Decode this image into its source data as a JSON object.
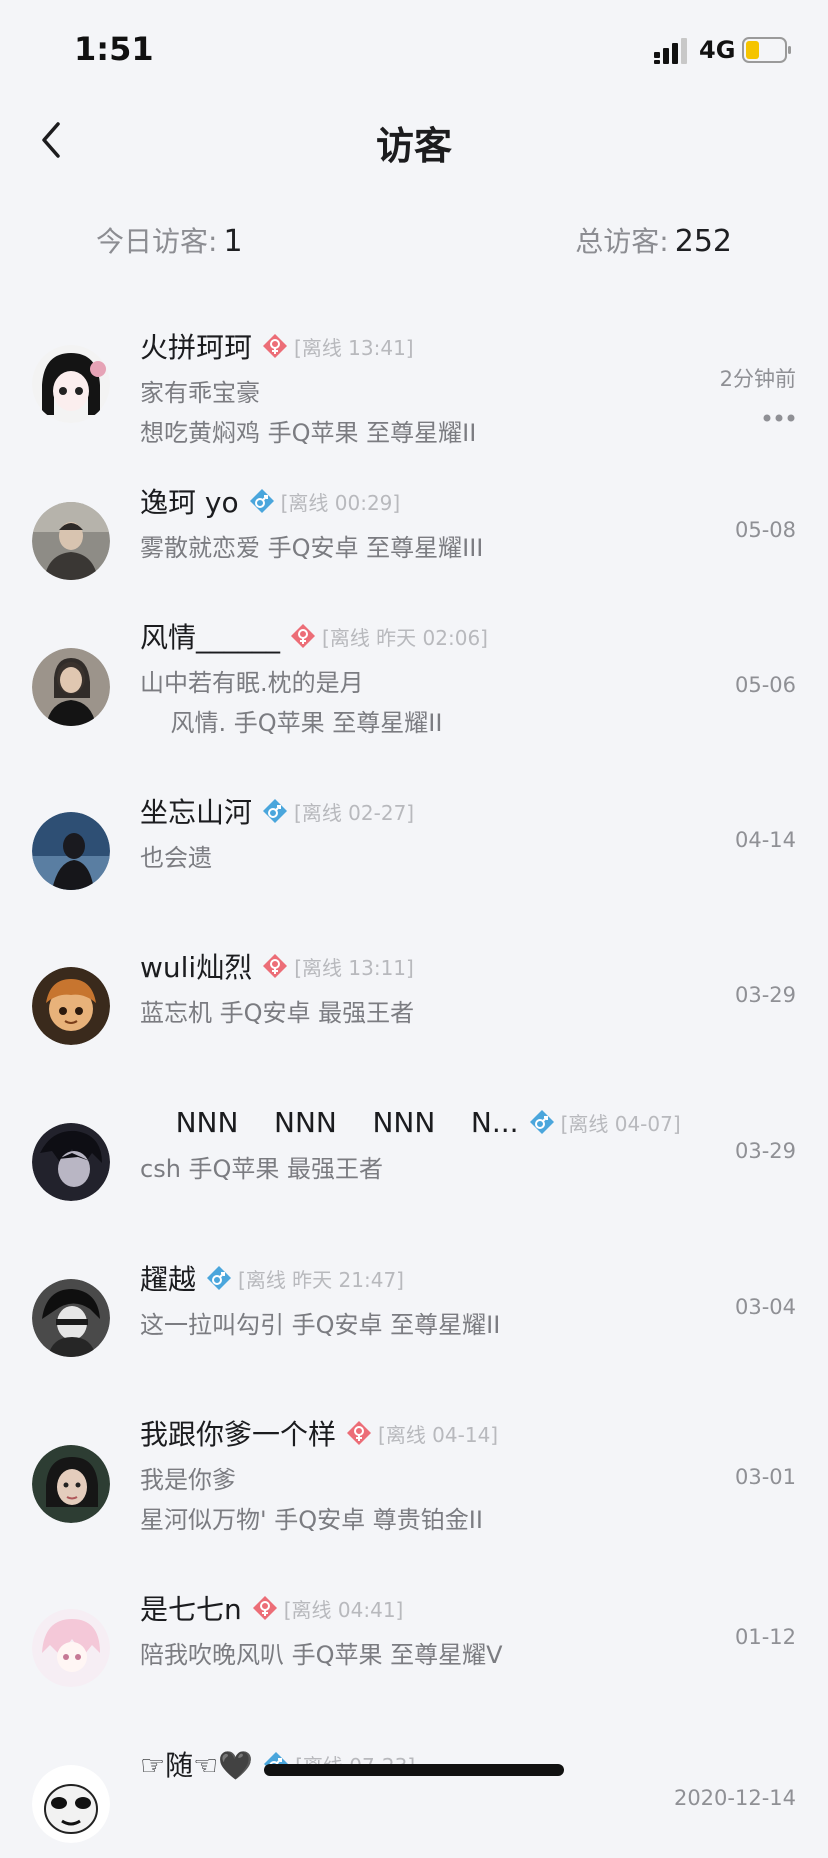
{
  "status_bar": {
    "time": "1:51",
    "network": "4G"
  },
  "header": {
    "title": "访客"
  },
  "stats": {
    "today_label": "今日访客:",
    "today_value": "1",
    "total_label": "总访客:",
    "total_value": "252"
  },
  "visitors": [
    {
      "name": "火拼珂珂",
      "gender": "female",
      "status": "[离线 13:41]",
      "line1": "家有乖宝豪",
      "line2": "想吃黄焖鸡    手Q苹果 至尊星耀II",
      "time": "2分钟前"
    },
    {
      "name": "逸珂 yo",
      "gender": "male",
      "status": "[离线 00:29]",
      "line1": "雾散就恋爱 手Q安卓 至尊星耀III",
      "line2": "",
      "time": "05-08"
    },
    {
      "name": "风情______",
      "gender": "female",
      "status": "[离线 昨天 02:06]",
      "line1": "山中若有眠.枕的是月",
      "line2": "    风情. 手Q苹果 至尊星耀II",
      "time": "05-06"
    },
    {
      "name": "坐忘山河",
      "gender": "male",
      "status": "[离线 02-27]",
      "line1": "也会遗",
      "line2": "",
      "time": "04-14"
    },
    {
      "name": "wuli灿烈",
      "gender": "female",
      "status": "[离线 13:11]",
      "line1": "蓝忘机 手Q安卓 最强王者",
      "line2": "",
      "time": "03-29"
    },
    {
      "name": "    NNN    NNN    NNN    N...",
      "gender": "male",
      "status": "[离线 04-07]",
      "line1": "csh 手Q苹果 最强王者",
      "line2": "",
      "time": "03-29"
    },
    {
      "name": "趯越",
      "gender": "male",
      "status": "[离线 昨天 21:47]",
      "line1": "这一拉叫勾引 手Q安卓 至尊星耀II",
      "line2": "",
      "time": "03-04"
    },
    {
      "name": "我跟你爹一个样",
      "gender": "female",
      "status": "[离线 04-14]",
      "line1": "我是你爹",
      "line2": "星河似万物' 手Q安卓 尊贵铂金II",
      "time": "03-01"
    },
    {
      "name": "是七七n",
      "gender": "female",
      "status": "[离线 04:41]",
      "line1": "陪我吹晚风叭 手Q苹果 至尊星耀V",
      "line2": "",
      "time": "01-12"
    },
    {
      "name": "☞随☜🖤",
      "gender": "male",
      "status": "[离线 07-23]",
      "line1": "",
      "line2": "",
      "time": "2020-12-14"
    }
  ],
  "colors": {
    "female": "#ec6d77",
    "male": "#4aa6dc",
    "background": "#f4f5f8"
  },
  "icons": {
    "back": "chevron-left-icon",
    "more": "more-horizontal-icon",
    "female": "female-gender-icon",
    "male": "male-gender-icon"
  }
}
